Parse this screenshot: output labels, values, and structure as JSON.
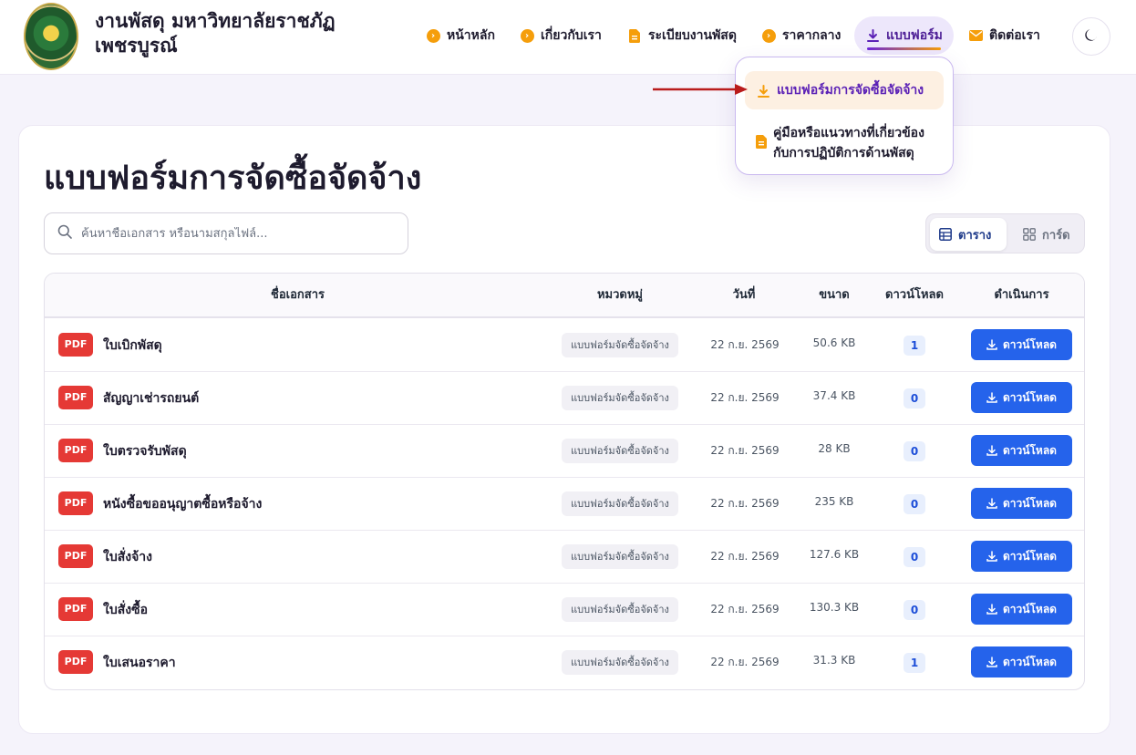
{
  "header": {
    "site_title": "งานพัสดุ มหาวิทยาลัยราชภัฏเพชรบูรณ์",
    "nav": [
      {
        "label": "หน้าหลัก",
        "icon": "chevron-circle-icon"
      },
      {
        "label": "เกี่ยวกับเรา",
        "icon": "chevron-circle-icon"
      },
      {
        "label": "ระเบียบงานพัสดุ",
        "icon": "document-icon"
      },
      {
        "label": "ราคากลาง",
        "icon": "chevron-circle-icon"
      },
      {
        "label": "แบบฟอร์ม",
        "icon": "download-icon",
        "active": true
      },
      {
        "label": "ติดต่อเรา",
        "icon": "envelope-icon"
      }
    ],
    "theme_icon": "moon-icon"
  },
  "dropdown": {
    "items": [
      {
        "label": "แบบฟอร์มการจัดซื้อจัดจ้าง",
        "icon": "download-icon",
        "active": true
      },
      {
        "label": "คู่มือหรือแนวทางที่เกี่ยวข้องกับการปฏิบัติการด้านพัสดุ",
        "icon": "document-icon"
      }
    ]
  },
  "page": {
    "title": "แบบฟอร์มการจัดซื้อจัดจ้าง",
    "search_placeholder": "ค้นหาชื่อเอกสาร หรือนามสกุลไฟล์...",
    "view_toggle": {
      "table_label": "ตาราง",
      "card_label": "การ์ด",
      "selected": "table"
    }
  },
  "table": {
    "headers": {
      "name": "ชื่อเอกสาร",
      "category": "หมวดหมู่",
      "date": "วันที่",
      "size": "ขนาด",
      "downloads": "ดาวน์โหลด",
      "actions": "ดำเนินการ"
    },
    "rows": [
      {
        "type": "PDF",
        "name": "ใบเบิกพัสดุ",
        "category": "แบบฟอร์มจัดซื้อจัดจ้าง",
        "date": "22 ก.ย. 2569",
        "size": "50.6 KB",
        "downloads": "1",
        "action": "ดาวน์โหลด"
      },
      {
        "type": "PDF",
        "name": "สัญญาเช่ารถยนต์",
        "category": "แบบฟอร์มจัดซื้อจัดจ้าง",
        "date": "22 ก.ย. 2569",
        "size": "37.4 KB",
        "downloads": "0",
        "action": "ดาวน์โหลด"
      },
      {
        "type": "PDF",
        "name": "ใบตรวจรับพัสดุ",
        "category": "แบบฟอร์มจัดซื้อจัดจ้าง",
        "date": "22 ก.ย. 2569",
        "size": "28 KB",
        "downloads": "0",
        "action": "ดาวน์โหลด"
      },
      {
        "type": "PDF",
        "name": "หนังซื้อขออนุญาตซื้อหรือจ้าง",
        "category": "แบบฟอร์มจัดซื้อจัดจ้าง",
        "date": "22 ก.ย. 2569",
        "size": "235 KB",
        "downloads": "0",
        "action": "ดาวน์โหลด"
      },
      {
        "type": "PDF",
        "name": "ใบสั่งจ้าง",
        "category": "แบบฟอร์มจัดซื้อจัดจ้าง",
        "date": "22 ก.ย. 2569",
        "size": "127.6 KB",
        "downloads": "0",
        "action": "ดาวน์โหลด"
      },
      {
        "type": "PDF",
        "name": "ใบสั่งซื้อ",
        "category": "แบบฟอร์มจัดซื้อจัดจ้าง",
        "date": "22 ก.ย. 2569",
        "size": "130.3 KB",
        "downloads": "0",
        "action": "ดาวน์โหลด"
      },
      {
        "type": "PDF",
        "name": "ใบเสนอราคา",
        "category": "แบบฟอร์มจัดซื้อจัดจ้าง",
        "date": "22 ก.ย. 2569",
        "size": "31.3 KB",
        "downloads": "1",
        "action": "ดาวน์โหลด"
      }
    ]
  },
  "colors": {
    "accent_purple": "#6d28d9",
    "accent_orange": "#f59e0b",
    "button_blue": "#2563eb",
    "pdf_red": "#e53935"
  }
}
